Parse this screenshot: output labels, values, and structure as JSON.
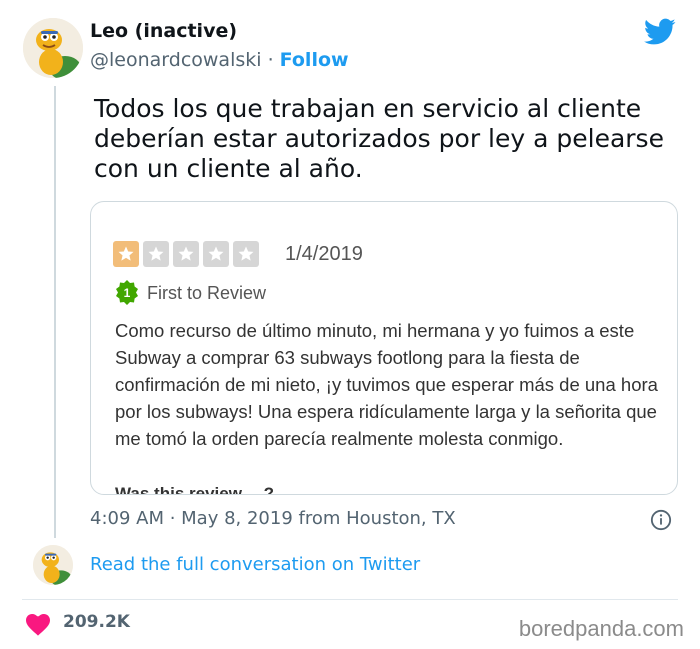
{
  "tweet": {
    "author_name": "Leo (inactive)",
    "handle": "@leonardcowalski",
    "separator": "·",
    "follow_label": "Follow",
    "text": "Todos los que trabajan en servicio al cliente deberían estar autorizados por ley a pelearse con un cliente al año.",
    "timestamp": "4:09 AM · May 8, 2019 from Houston, TX",
    "read_full": "Read the full conversation on Twitter",
    "likes": "209.2K"
  },
  "review": {
    "rating": 1,
    "max_rating": 5,
    "date": "1/4/2019",
    "badge_number": "1",
    "badge_label": "First to Review",
    "body": "Como recurso de último minuto, mi hermana y yo fuimos a este Subway a comprar 63 subways footlong para la fiesta de confirmación de mi nieto, ¡y tuvimos que esperar más de una hora por los subways! Una espera ridículamente larga y la señorita que me tomó la orden parecía realmente molesta conmigo.",
    "cut_off_text": "Was this review …?"
  },
  "watermark": "boredpanda.com",
  "colors": {
    "accent": "#1d9bf0",
    "heart": "#f91880",
    "star_filled": "#f2bd79",
    "star_empty": "#d6d6d6",
    "badge": "#41a700"
  },
  "icons": [
    "twitter-bird-icon",
    "star-icon",
    "first-review-badge-icon",
    "info-icon",
    "heart-icon"
  ]
}
